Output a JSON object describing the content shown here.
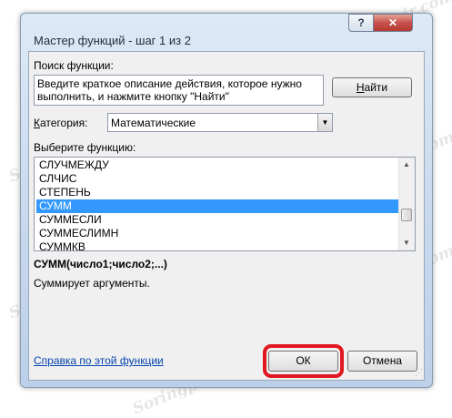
{
  "window": {
    "title": "Мастер функций - шаг 1 из 2",
    "help_glyph": "?",
    "close_glyph": "✕"
  },
  "search": {
    "label": "Поиск функции:",
    "text": "Введите краткое описание действия, которое нужно выполнить, и нажмите кнопку \"Найти\"",
    "find_button": {
      "accel": "Н",
      "rest": "айти"
    }
  },
  "category": {
    "accel": "К",
    "rest": "атегория:",
    "value": "Математические"
  },
  "function_list": {
    "label": "Выберите функцию:",
    "items": [
      "СЛУЧМЕЖДУ",
      "СЛЧИС",
      "СТЕПЕНЬ",
      "СУММ",
      "СУММЕСЛИ",
      "СУММЕСЛИМН",
      "СУММКВ"
    ],
    "selected": "СУММ"
  },
  "selected_function": {
    "syntax": "СУММ(число1;число2;...)",
    "description": "Суммирует аргументы."
  },
  "footer": {
    "help_link": "Справка по этой функции",
    "ok_label": "ОК",
    "cancel_label": "Отмена"
  },
  "colors": {
    "selection": "#3399ff",
    "highlight_border": "#e0171f",
    "link": "#0645ad"
  },
  "watermark": "Soringpcrepair.com"
}
